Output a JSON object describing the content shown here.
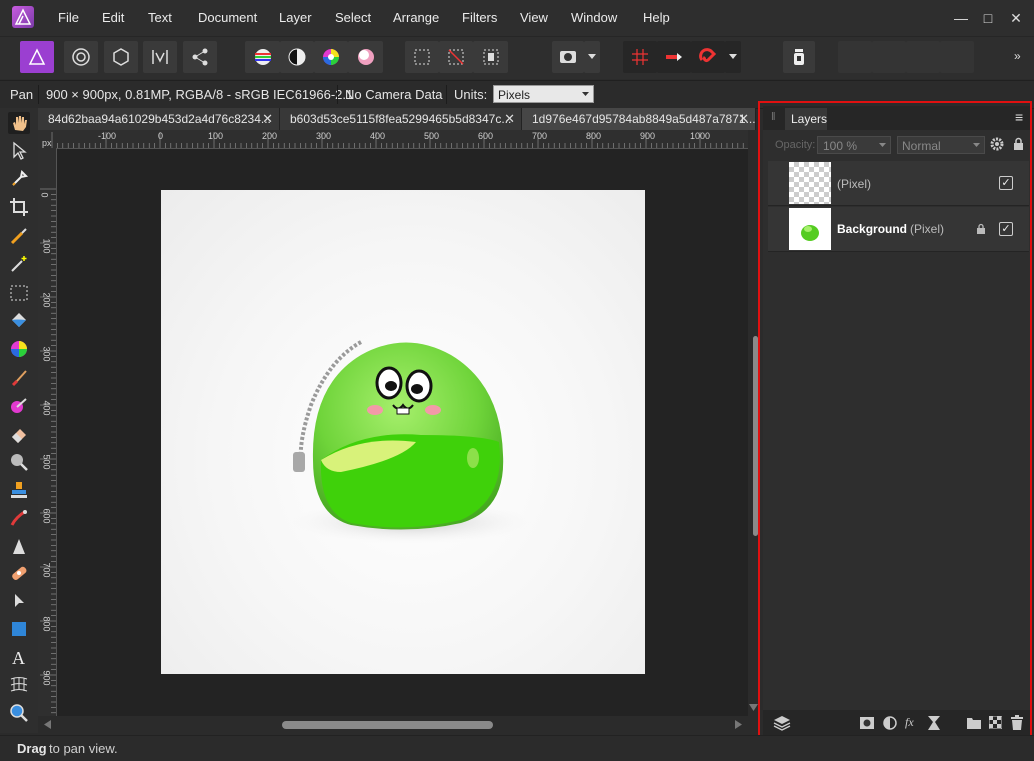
{
  "app": {
    "logo_icon": "affinity-photo-logo-icon"
  },
  "menu": [
    "File",
    "Edit",
    "Text",
    "Document",
    "Layer",
    "Select",
    "Arrange",
    "Filters",
    "View",
    "Window",
    "Help"
  ],
  "window_controls": {
    "minimize": "—",
    "maximize": "□",
    "close": "✕"
  },
  "context": {
    "tool_name": "Pan",
    "doc_info": "900 × 900px, 0.81MP, RGBA/8 - sRGB IEC61966-2.1",
    "camera": "No Camera Data",
    "units_label": "Units:",
    "units_value": "Pixels"
  },
  "tabs": [
    {
      "label": "84d62baa94a61029b453d2a4d76c8234...",
      "close": "✕"
    },
    {
      "label": "b603d53ce5115f8fea5299465b5d8347c...",
      "close": "✕"
    },
    {
      "label": "1d976e467d95784ab8849a5d487a7871...",
      "close": "✕"
    }
  ],
  "rulers": {
    "unit": "px",
    "h_ticks": [
      "-100",
      "0",
      "100",
      "200",
      "300",
      "400",
      "500",
      "600",
      "700",
      "800",
      "900",
      "1000"
    ],
    "v_ticks": [
      "0",
      "100",
      "200",
      "300",
      "400",
      "500",
      "600",
      "700",
      "800",
      "900"
    ]
  },
  "layers_panel": {
    "title": "Layers",
    "opacity_label": "Opacity:",
    "opacity_value": "100 %",
    "blend_mode": "Normal",
    "layers": [
      {
        "name": "",
        "type": "(Pixel)",
        "checked": "✓"
      },
      {
        "name": "Background",
        "type": "(Pixel)",
        "checked": "✓",
        "locked": "🔒"
      }
    ]
  },
  "status": {
    "bold": "Drag",
    "text": " to pan view."
  },
  "colors": {
    "accent": "#9b3fd1",
    "highlight": "#e01010",
    "doc_bg": "#f5f5f5",
    "toy_green": "#6fd43a"
  }
}
